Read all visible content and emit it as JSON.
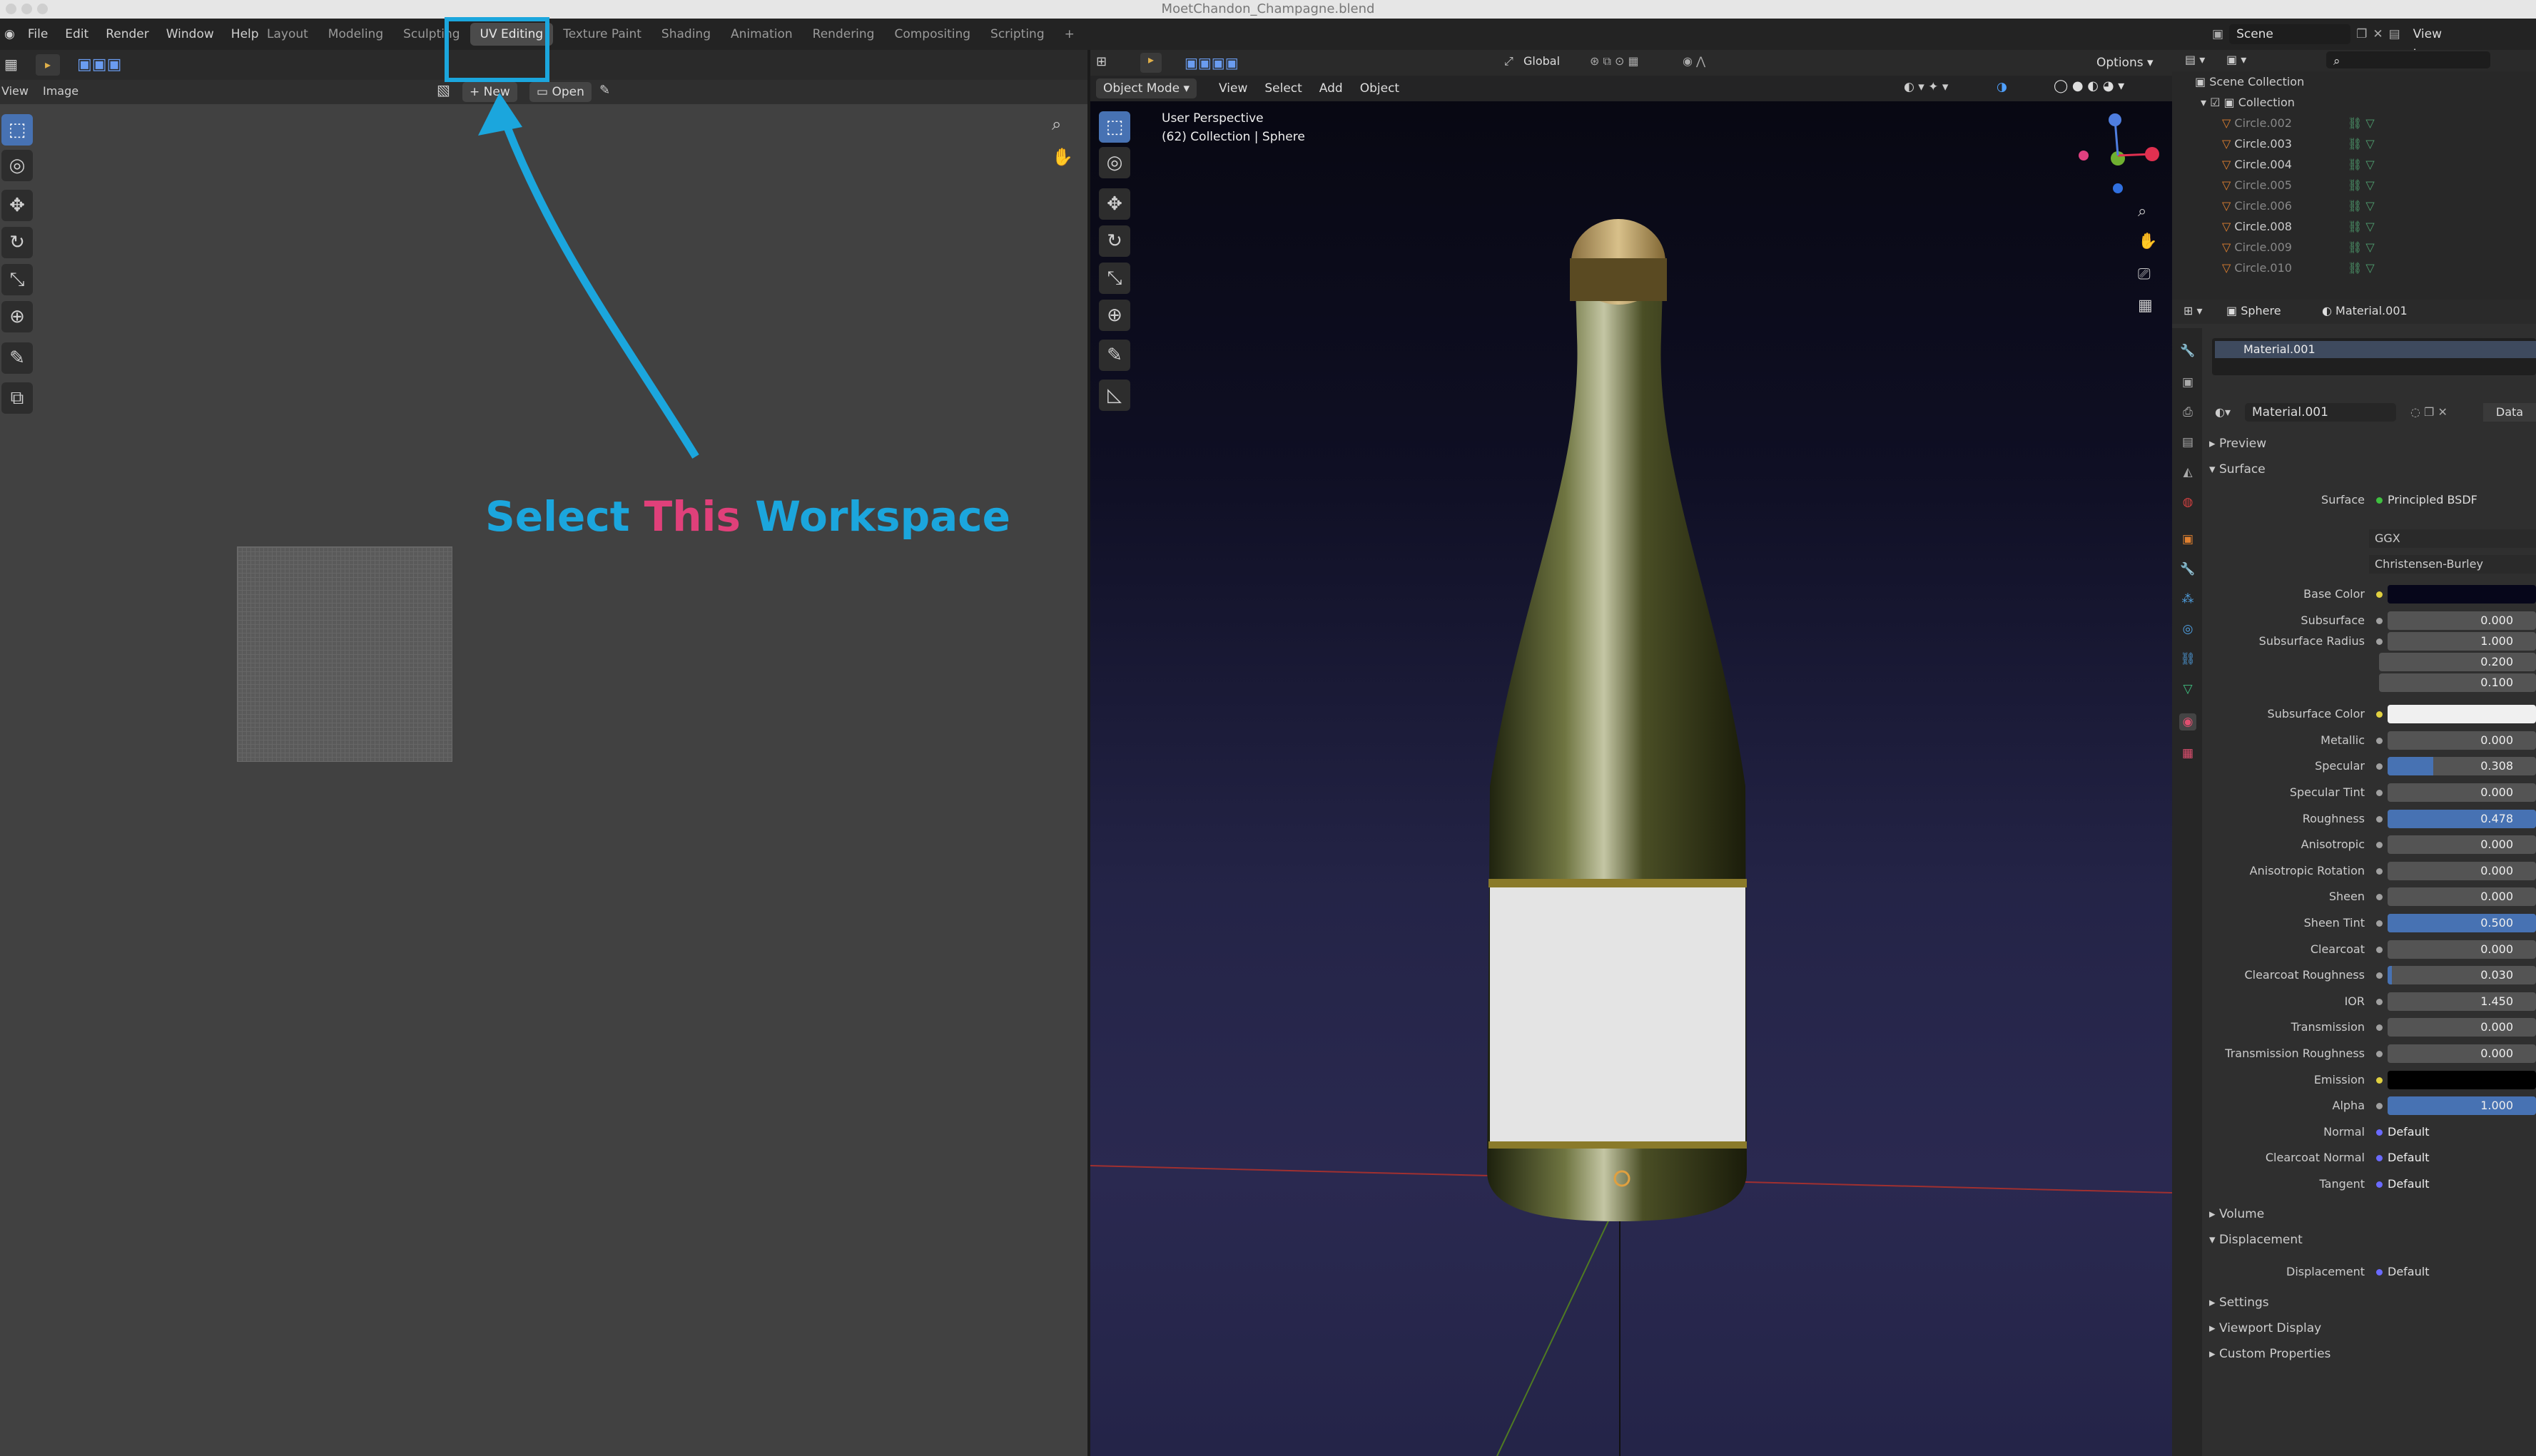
{
  "window": {
    "title": "MoetChandon_Champagne.blend"
  },
  "menu": [
    "File",
    "Edit",
    "Render",
    "Window",
    "Help"
  ],
  "workspaces": [
    {
      "label": "Layout",
      "active": false
    },
    {
      "label": "Modeling",
      "active": false
    },
    {
      "label": "Sculpting",
      "active": false
    },
    {
      "label": "UV Editing",
      "active": true
    },
    {
      "label": "Texture Paint",
      "active": false
    },
    {
      "label": "Shading",
      "active": false
    },
    {
      "label": "Animation",
      "active": false
    },
    {
      "label": "Rendering",
      "active": false
    },
    {
      "label": "Compositing",
      "active": false
    },
    {
      "label": "Scripting",
      "active": false
    }
  ],
  "scene": {
    "name": "Scene",
    "view_layer": "View Layer"
  },
  "uv_editor": {
    "view_menu": "View",
    "image_menu": "Image",
    "new_label": "New",
    "open_label": "Open"
  },
  "viewport": {
    "mode": "Object Mode",
    "menus": [
      "View",
      "Select",
      "Add",
      "Object"
    ],
    "transform": "Global",
    "options": "Options",
    "overlay_line1": "User Perspective",
    "overlay_line2": "(62) Collection | Sphere"
  },
  "annotation": {
    "word1": "Select",
    "word2": "This",
    "word3": "Workspace",
    "color_blue": "#1ba6dd",
    "color_pink": "#e0407a"
  },
  "outliner": {
    "root": "Scene Collection",
    "collection": "Collection",
    "items": [
      "Circle.002",
      "Circle.003",
      "Circle.004",
      "Circle.005",
      "Circle.006",
      "Circle.008",
      "Circle.009",
      "Circle.010"
    ]
  },
  "properties": {
    "object": "Sphere",
    "material": "Material.001",
    "slot": "Material.001",
    "data_label": "Data",
    "preview": "Preview",
    "surface": "Surface",
    "surface_shader": "Principled BSDF",
    "distribution": "GGX",
    "subsurface_method": "Christensen-Burley",
    "params": [
      {
        "label": "Base Color",
        "value": "",
        "kind": "color",
        "color": "#06061a"
      },
      {
        "label": "Subsurface",
        "value": "0.000",
        "fill": 0
      },
      {
        "label": "Subsurface Radius",
        "value": "1.000",
        "fill": 0
      },
      {
        "label": "",
        "value": "0.200",
        "fill": 0
      },
      {
        "label": "",
        "value": "0.100",
        "fill": 0
      },
      {
        "label": "Subsurface Color",
        "value": "",
        "kind": "color",
        "color": "#f0f0f0"
      },
      {
        "label": "Metallic",
        "value": "0.000",
        "fill": 0
      },
      {
        "label": "Specular",
        "value": "0.308",
        "fill": 0.308
      },
      {
        "label": "Specular Tint",
        "value": "0.000",
        "fill": 0
      },
      {
        "label": "Roughness",
        "value": "0.478",
        "fill": 1
      },
      {
        "label": "Anisotropic",
        "value": "0.000",
        "fill": 0
      },
      {
        "label": "Anisotropic Rotation",
        "value": "0.000",
        "fill": 0
      },
      {
        "label": "Sheen",
        "value": "0.000",
        "fill": 0
      },
      {
        "label": "Sheen Tint",
        "value": "0.500",
        "fill": 1
      },
      {
        "label": "Clearcoat",
        "value": "0.000",
        "fill": 0
      },
      {
        "label": "Clearcoat Roughness",
        "value": "0.030",
        "fill": 0.03
      },
      {
        "label": "IOR",
        "value": "1.450",
        "fill": 0
      },
      {
        "label": "Transmission",
        "value": "0.000",
        "fill": 0
      },
      {
        "label": "Transmission Roughness",
        "value": "0.000",
        "fill": 0
      },
      {
        "label": "Emission",
        "value": "",
        "kind": "color",
        "color": "#000000"
      },
      {
        "label": "Alpha",
        "value": "1.000",
        "fill": 1
      },
      {
        "label": "Normal",
        "value": "Default",
        "kind": "link"
      },
      {
        "label": "Clearcoat Normal",
        "value": "Default",
        "kind": "link"
      },
      {
        "label": "Tangent",
        "value": "Default",
        "kind": "link"
      }
    ],
    "volume": "Volume",
    "displacement": "Displacement",
    "displacement_label": "Displacement",
    "displacement_value": "Default",
    "settings": "Settings",
    "viewport_display": "Viewport Display",
    "custom_props": "Custom Properties"
  }
}
